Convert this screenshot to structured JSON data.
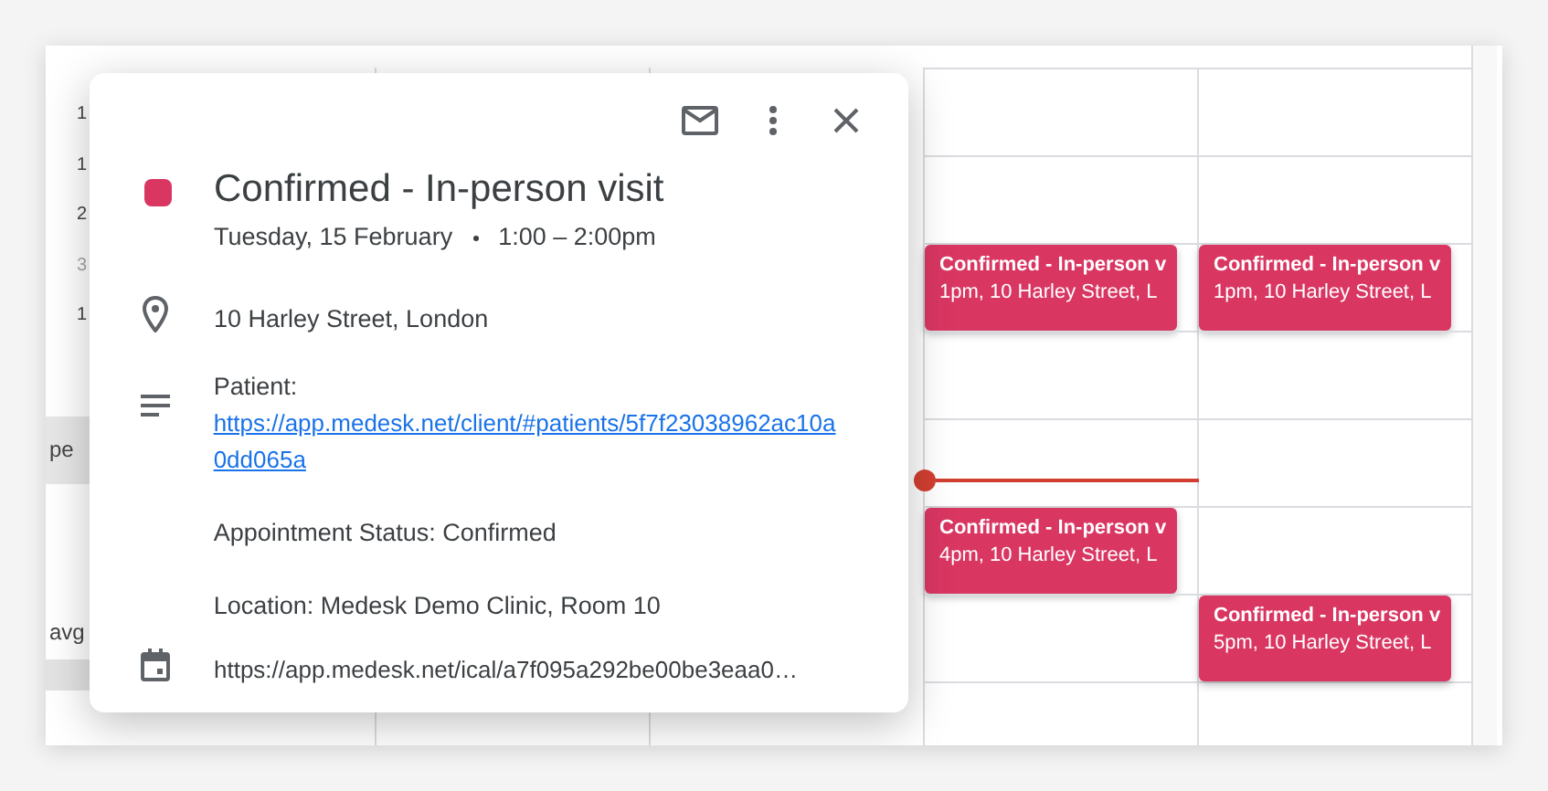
{
  "side_panel": {
    "day_numbers": [
      "1",
      "1",
      "2",
      "3",
      "1"
    ],
    "label_fragments": [
      "pe",
      "avg"
    ]
  },
  "days": [
    {
      "slots": [
        {
          "kind": "empty"
        },
        {
          "kind": "empty"
        },
        {
          "kind": "event",
          "title": "Confirmed - In-person v",
          "details": "1pm, 10 Harley Street, L"
        },
        {
          "kind": "empty"
        },
        {
          "kind": "now"
        },
        {
          "kind": "event",
          "title": "Confirmed - In-person v",
          "details": "4pm, 10 Harley Street, L"
        },
        {
          "kind": "empty"
        }
      ]
    },
    {
      "slots": [
        {
          "kind": "empty"
        },
        {
          "kind": "empty"
        },
        {
          "kind": "event",
          "title": "Confirmed - In-person v",
          "details": "1pm, 10 Harley Street, L"
        },
        {
          "kind": "empty"
        },
        {
          "kind": "empty"
        },
        {
          "kind": "empty"
        },
        {
          "kind": "event",
          "title": "Confirmed - In-person v",
          "details": "5pm, 10 Harley Street, L"
        }
      ]
    }
  ],
  "popup": {
    "title": "Confirmed - In-person visit",
    "color": "#d93662",
    "date": "Tuesday, 15 February",
    "time": "1:00 – 2:00pm",
    "location": "10 Harley Street, London",
    "description": {
      "label": "Patient:",
      "link": "https://app.medesk.net/client/#patients/5f7f23038962ac10a0dd065a",
      "lines": [
        "Appointment Status: Confirmed",
        "Location: Medesk Demo Clinic, Room 10"
      ]
    },
    "calendar_link": "https://app.medesk.net/ical/a7f095a292be00be3eaa0…"
  }
}
